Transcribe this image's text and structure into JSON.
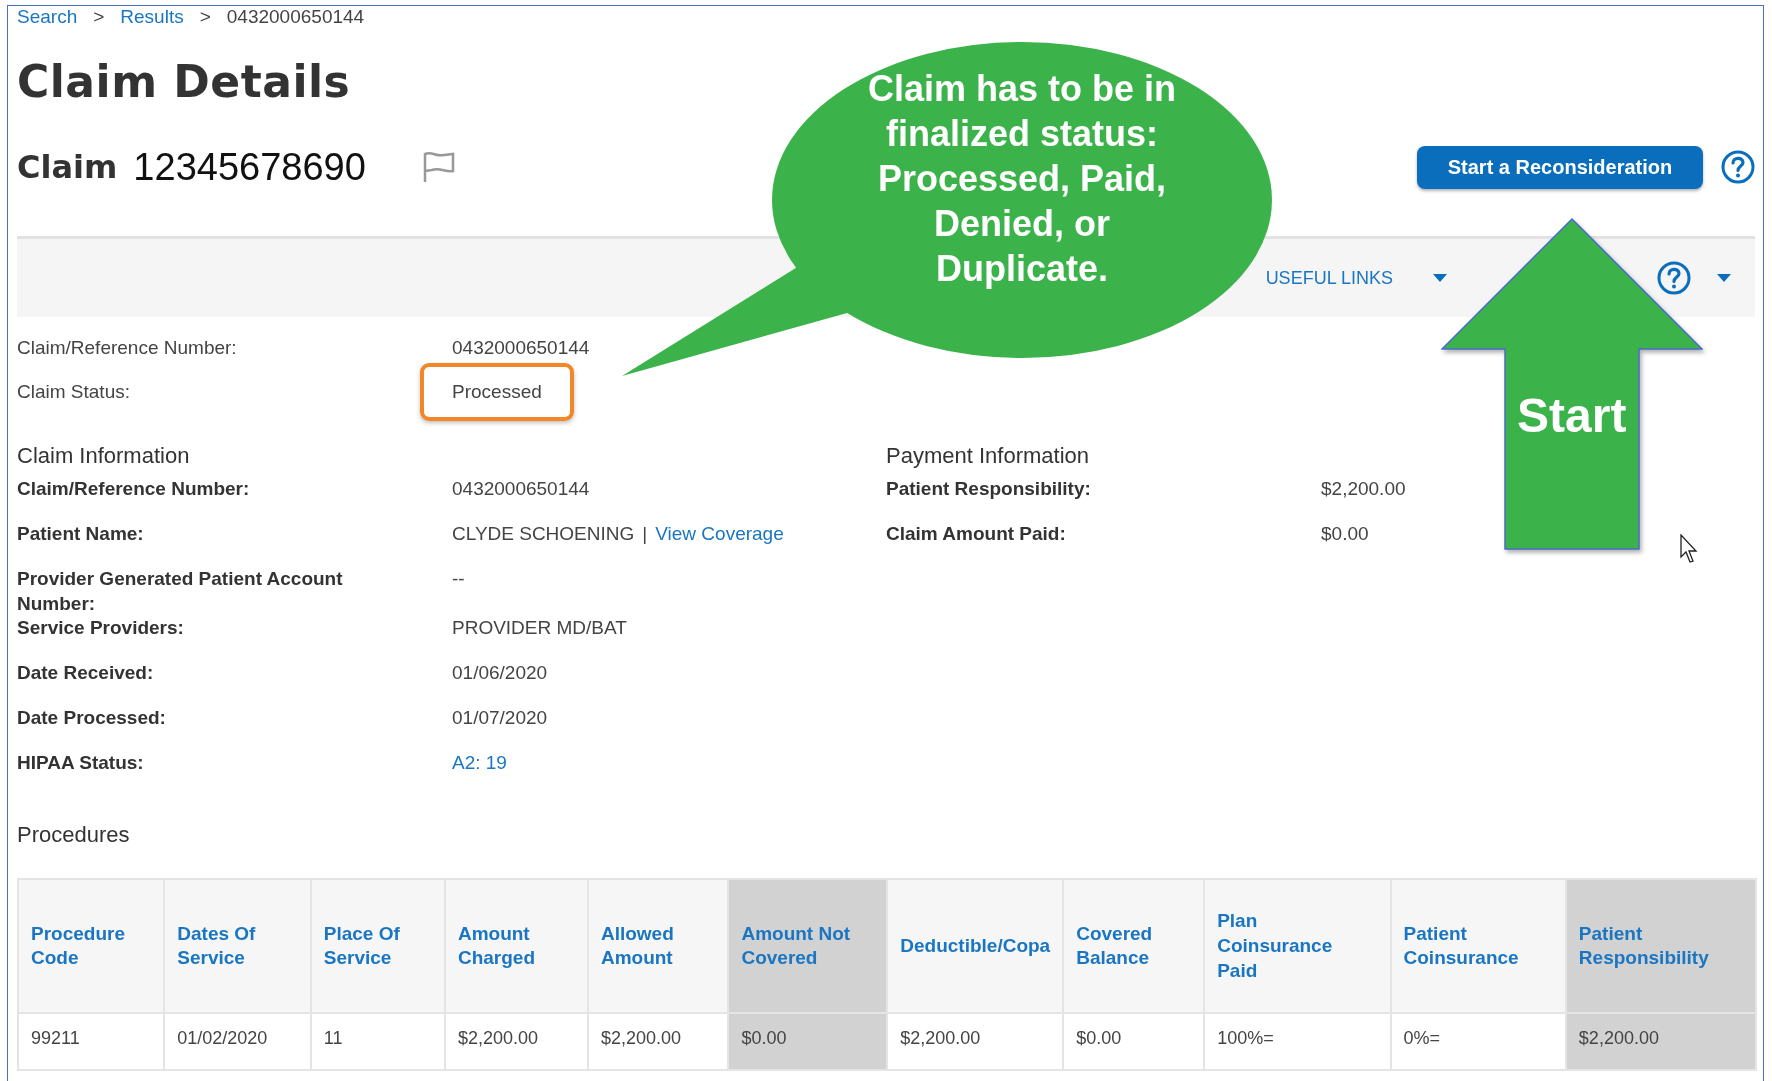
{
  "breadcrumb": [
    {
      "label": "Search",
      "kind": "link"
    },
    {
      "label": ">",
      "kind": "separator"
    },
    {
      "label": "Results",
      "kind": "link"
    },
    {
      "label": ">",
      "kind": "separator"
    },
    {
      "label": "0432000650144",
      "kind": "current"
    }
  ],
  "title": "Claim Details",
  "claim": {
    "label": "Claim",
    "number": "12345678690"
  },
  "reconsider_button": "Start a Reconsideration",
  "toolbar": {
    "useful_links": "USEFUL LINKS"
  },
  "summary": [
    {
      "label": "Claim/Reference Number:",
      "value": "0432000650144",
      "highlighted": false
    },
    {
      "label": "Claim Status:",
      "value": "Processed",
      "highlighted": true
    }
  ],
  "claim_information": {
    "heading": "Claim Information",
    "rows": [
      {
        "label": "Claim/Reference Number:",
        "value": "0432000650144",
        "kind": "text"
      },
      {
        "label": "Patient Name:",
        "value": "CLYDE SCHOENING",
        "kind": "text",
        "separator": "|",
        "link": "View Coverage"
      },
      {
        "label": "Provider Generated Patient Account Number:",
        "value": "--",
        "kind": "text"
      },
      {
        "label": "Service Providers:",
        "value": "PROVIDER MD/BAT",
        "kind": "text"
      },
      {
        "label": "Date Received:",
        "value": "01/06/2020",
        "kind": "text"
      },
      {
        "label": "Date Processed:",
        "value": "01/07/2020",
        "kind": "text"
      },
      {
        "label": "HIPAA Status:",
        "value": "A2: 19",
        "kind": "link"
      }
    ]
  },
  "payment_information": {
    "heading": "Payment Information",
    "rows": [
      {
        "label": "Patient Responsibility:",
        "value": "$2,200.00"
      },
      {
        "label": "Claim Amount Paid:",
        "value": "$0.00"
      }
    ]
  },
  "procedures": {
    "heading": "Procedures",
    "columns": [
      {
        "label": "Procedure Code",
        "shaded": false
      },
      {
        "label": "Dates Of Service",
        "shaded": false
      },
      {
        "label": "Place Of Service",
        "shaded": false
      },
      {
        "label": "Amount Charged",
        "shaded": false
      },
      {
        "label": "Allowed Amount",
        "shaded": false
      },
      {
        "label": "Amount Not Covered",
        "shaded": true
      },
      {
        "label": "Deductible/Copa",
        "shaded": false
      },
      {
        "label": "Covered Balance",
        "shaded": false
      },
      {
        "label": "Plan Coinsurance Paid",
        "shaded": false
      },
      {
        "label": "Patient Coinsurance",
        "shaded": false
      },
      {
        "label": "Patient Responsibility",
        "shaded": true
      }
    ],
    "rows": [
      [
        "99211",
        "01/02/2020",
        "11",
        "$2,200.00",
        "$2,200.00",
        "$0.00",
        "$2,200.00",
        "$0.00",
        "100%=",
        "0%=",
        "$2,200.00"
      ]
    ]
  },
  "callout": {
    "text": "Claim has to be in finalized status: Processed, Paid, Denied, or Duplicate."
  },
  "arrow": {
    "label": "Start"
  }
}
